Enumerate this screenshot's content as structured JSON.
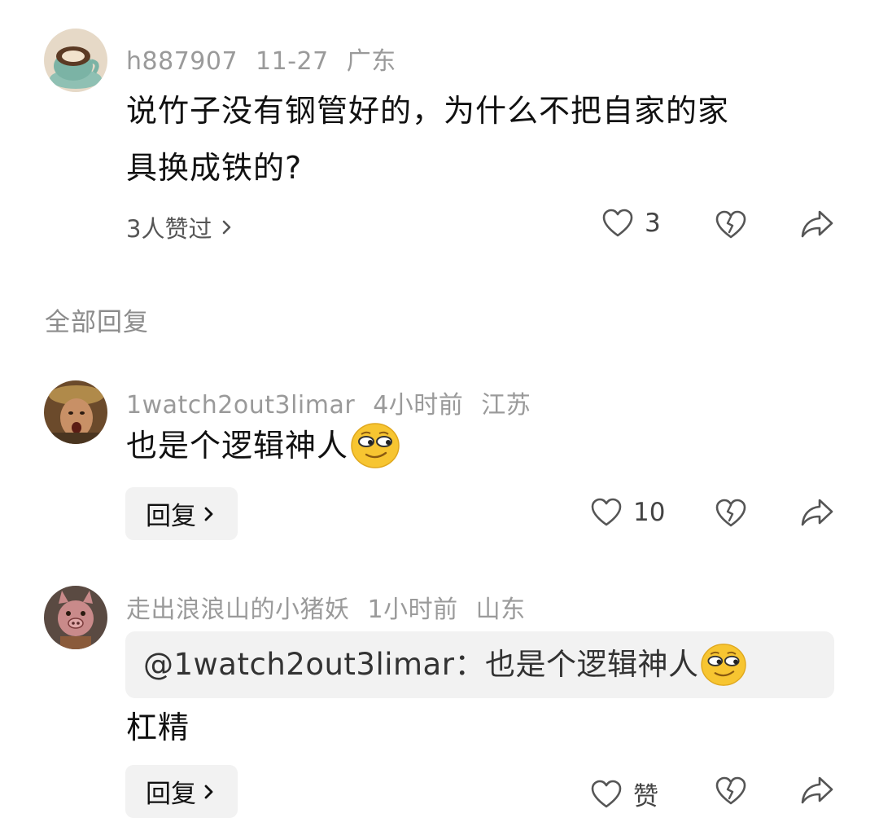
{
  "main_comment": {
    "username": "h887907",
    "date": "11-27",
    "location": "广东",
    "text_line1": "说竹子没有钢管好的，为什么不把自家的家",
    "text_line2": "具换成铁的?",
    "likes_who": "3人赞过",
    "like_count": "3",
    "avatar": "coffee-cup-avatar"
  },
  "section_title": "全部回复",
  "replies": [
    {
      "username": "1watch2out3limar",
      "time": "4小时前",
      "location": "江苏",
      "text": "也是个逻辑神人",
      "emoji": "smirk-emoji",
      "reply_label": "回复",
      "like_count": "10",
      "avatar": "man-portrait-avatar"
    },
    {
      "username": "走出浪浪山的小猪妖",
      "time": "1小时前",
      "location": "山东",
      "quote": "@1watch2out3limar：也是个逻辑神人",
      "quote_emoji": "smirk-emoji",
      "text": "杠精",
      "reply_label": "回复",
      "like_label": "赞",
      "avatar": "pig-demon-avatar"
    }
  ],
  "icons": {
    "like": "heart-outline-icon",
    "dislike": "broken-heart-icon",
    "share": "share-arrow-icon",
    "chevron": "chevron-right-icon"
  },
  "colors": {
    "meta_text": "#9a9a9a",
    "reply_bg": "#f2f2f2",
    "emoji_yellow": "#f7c531"
  }
}
